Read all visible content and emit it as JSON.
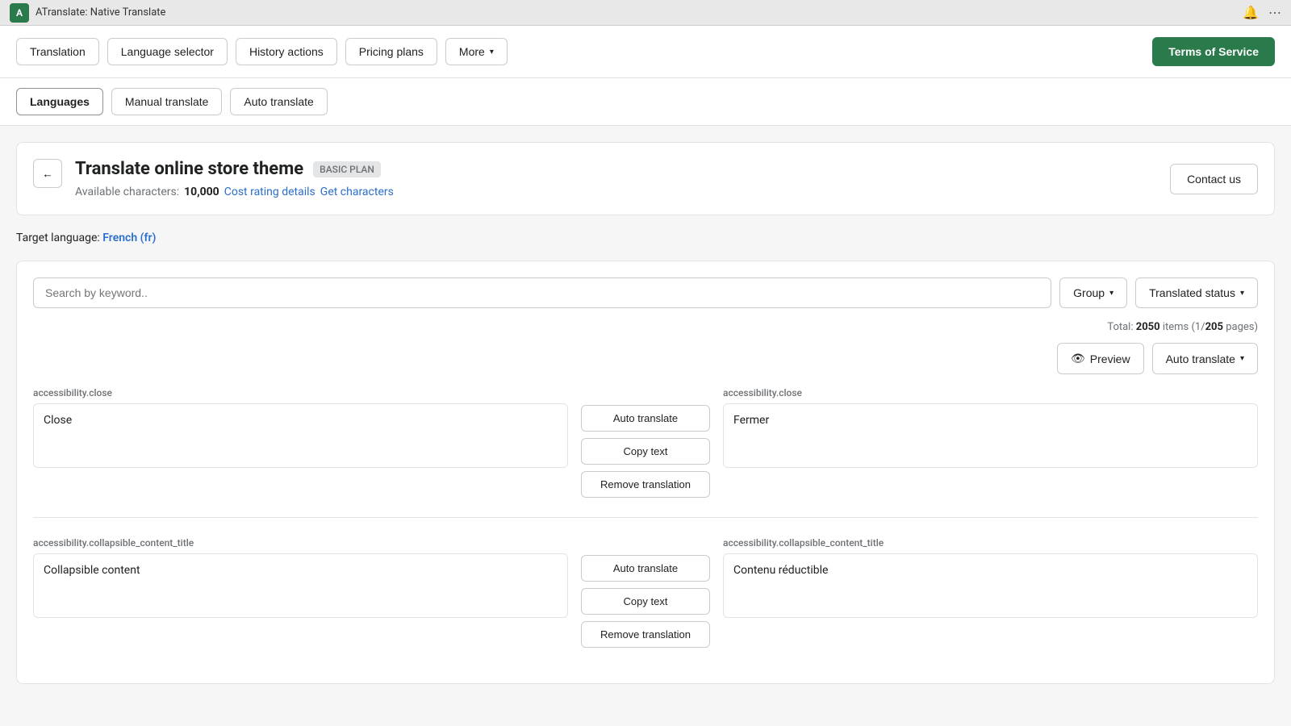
{
  "browser": {
    "title": "ATranslate: Native Translate",
    "logo_letter": "A",
    "bell_icon": "🔔",
    "menu_icon": "⋯"
  },
  "top_nav": {
    "items": [
      {
        "id": "translation",
        "label": "Translation",
        "active": false
      },
      {
        "id": "language-selector",
        "label": "Language selector",
        "active": false
      },
      {
        "id": "history-actions",
        "label": "History actions",
        "active": false
      },
      {
        "id": "pricing-plans",
        "label": "Pricing plans",
        "active": false
      },
      {
        "id": "more",
        "label": "More",
        "active": false,
        "has_chevron": true
      }
    ],
    "cta_label": "Terms of Service"
  },
  "sub_nav": {
    "items": [
      {
        "id": "languages",
        "label": "Languages",
        "active": true
      },
      {
        "id": "manual-translate",
        "label": "Manual translate",
        "active": false
      },
      {
        "id": "auto-translate",
        "label": "Auto translate",
        "active": false
      }
    ]
  },
  "page_header": {
    "back_icon": "←",
    "title": "Translate online store theme",
    "badge": "BASIC PLAN",
    "chars_label": "Available characters:",
    "chars_value": "10,000",
    "cost_rating_link": "Cost rating details",
    "get_chars_link": "Get characters",
    "contact_label": "Contact us"
  },
  "target_language": {
    "label": "Target language:",
    "value": "French (fr)"
  },
  "filter_bar": {
    "search_placeholder": "Search by keyword..",
    "group_label": "Group",
    "translated_status_label": "Translated status"
  },
  "stats": {
    "total_label": "Total:",
    "total_count": "2050",
    "pages_text": "items (1/205 pages)"
  },
  "actions": {
    "preview_label": "Preview",
    "preview_icon": "👁",
    "auto_translate_label": "Auto translate",
    "chevron": "▾"
  },
  "translation_rows": [
    {
      "source_key": "accessibility.close",
      "source_text": "Close",
      "actions": {
        "auto_translate": "Auto translate",
        "copy_text": "Copy text",
        "remove_translation": "Remove translation"
      },
      "target_key": "accessibility.close",
      "target_text": "Fermer"
    },
    {
      "source_key": "accessibility.collapsible_content_title",
      "source_text": "Collapsible content",
      "actions": {
        "auto_translate": "Auto translate",
        "copy_text": "Copy text",
        "remove_translation": "Remove translation"
      },
      "target_key": "accessibility.collapsible_content_title",
      "target_text": "Contenu réductible"
    }
  ],
  "colors": {
    "brand_green": "#2a7a4b",
    "link_blue": "#2c6ecb",
    "badge_bg": "#e4e5e7",
    "badge_text": "#6d7175"
  }
}
